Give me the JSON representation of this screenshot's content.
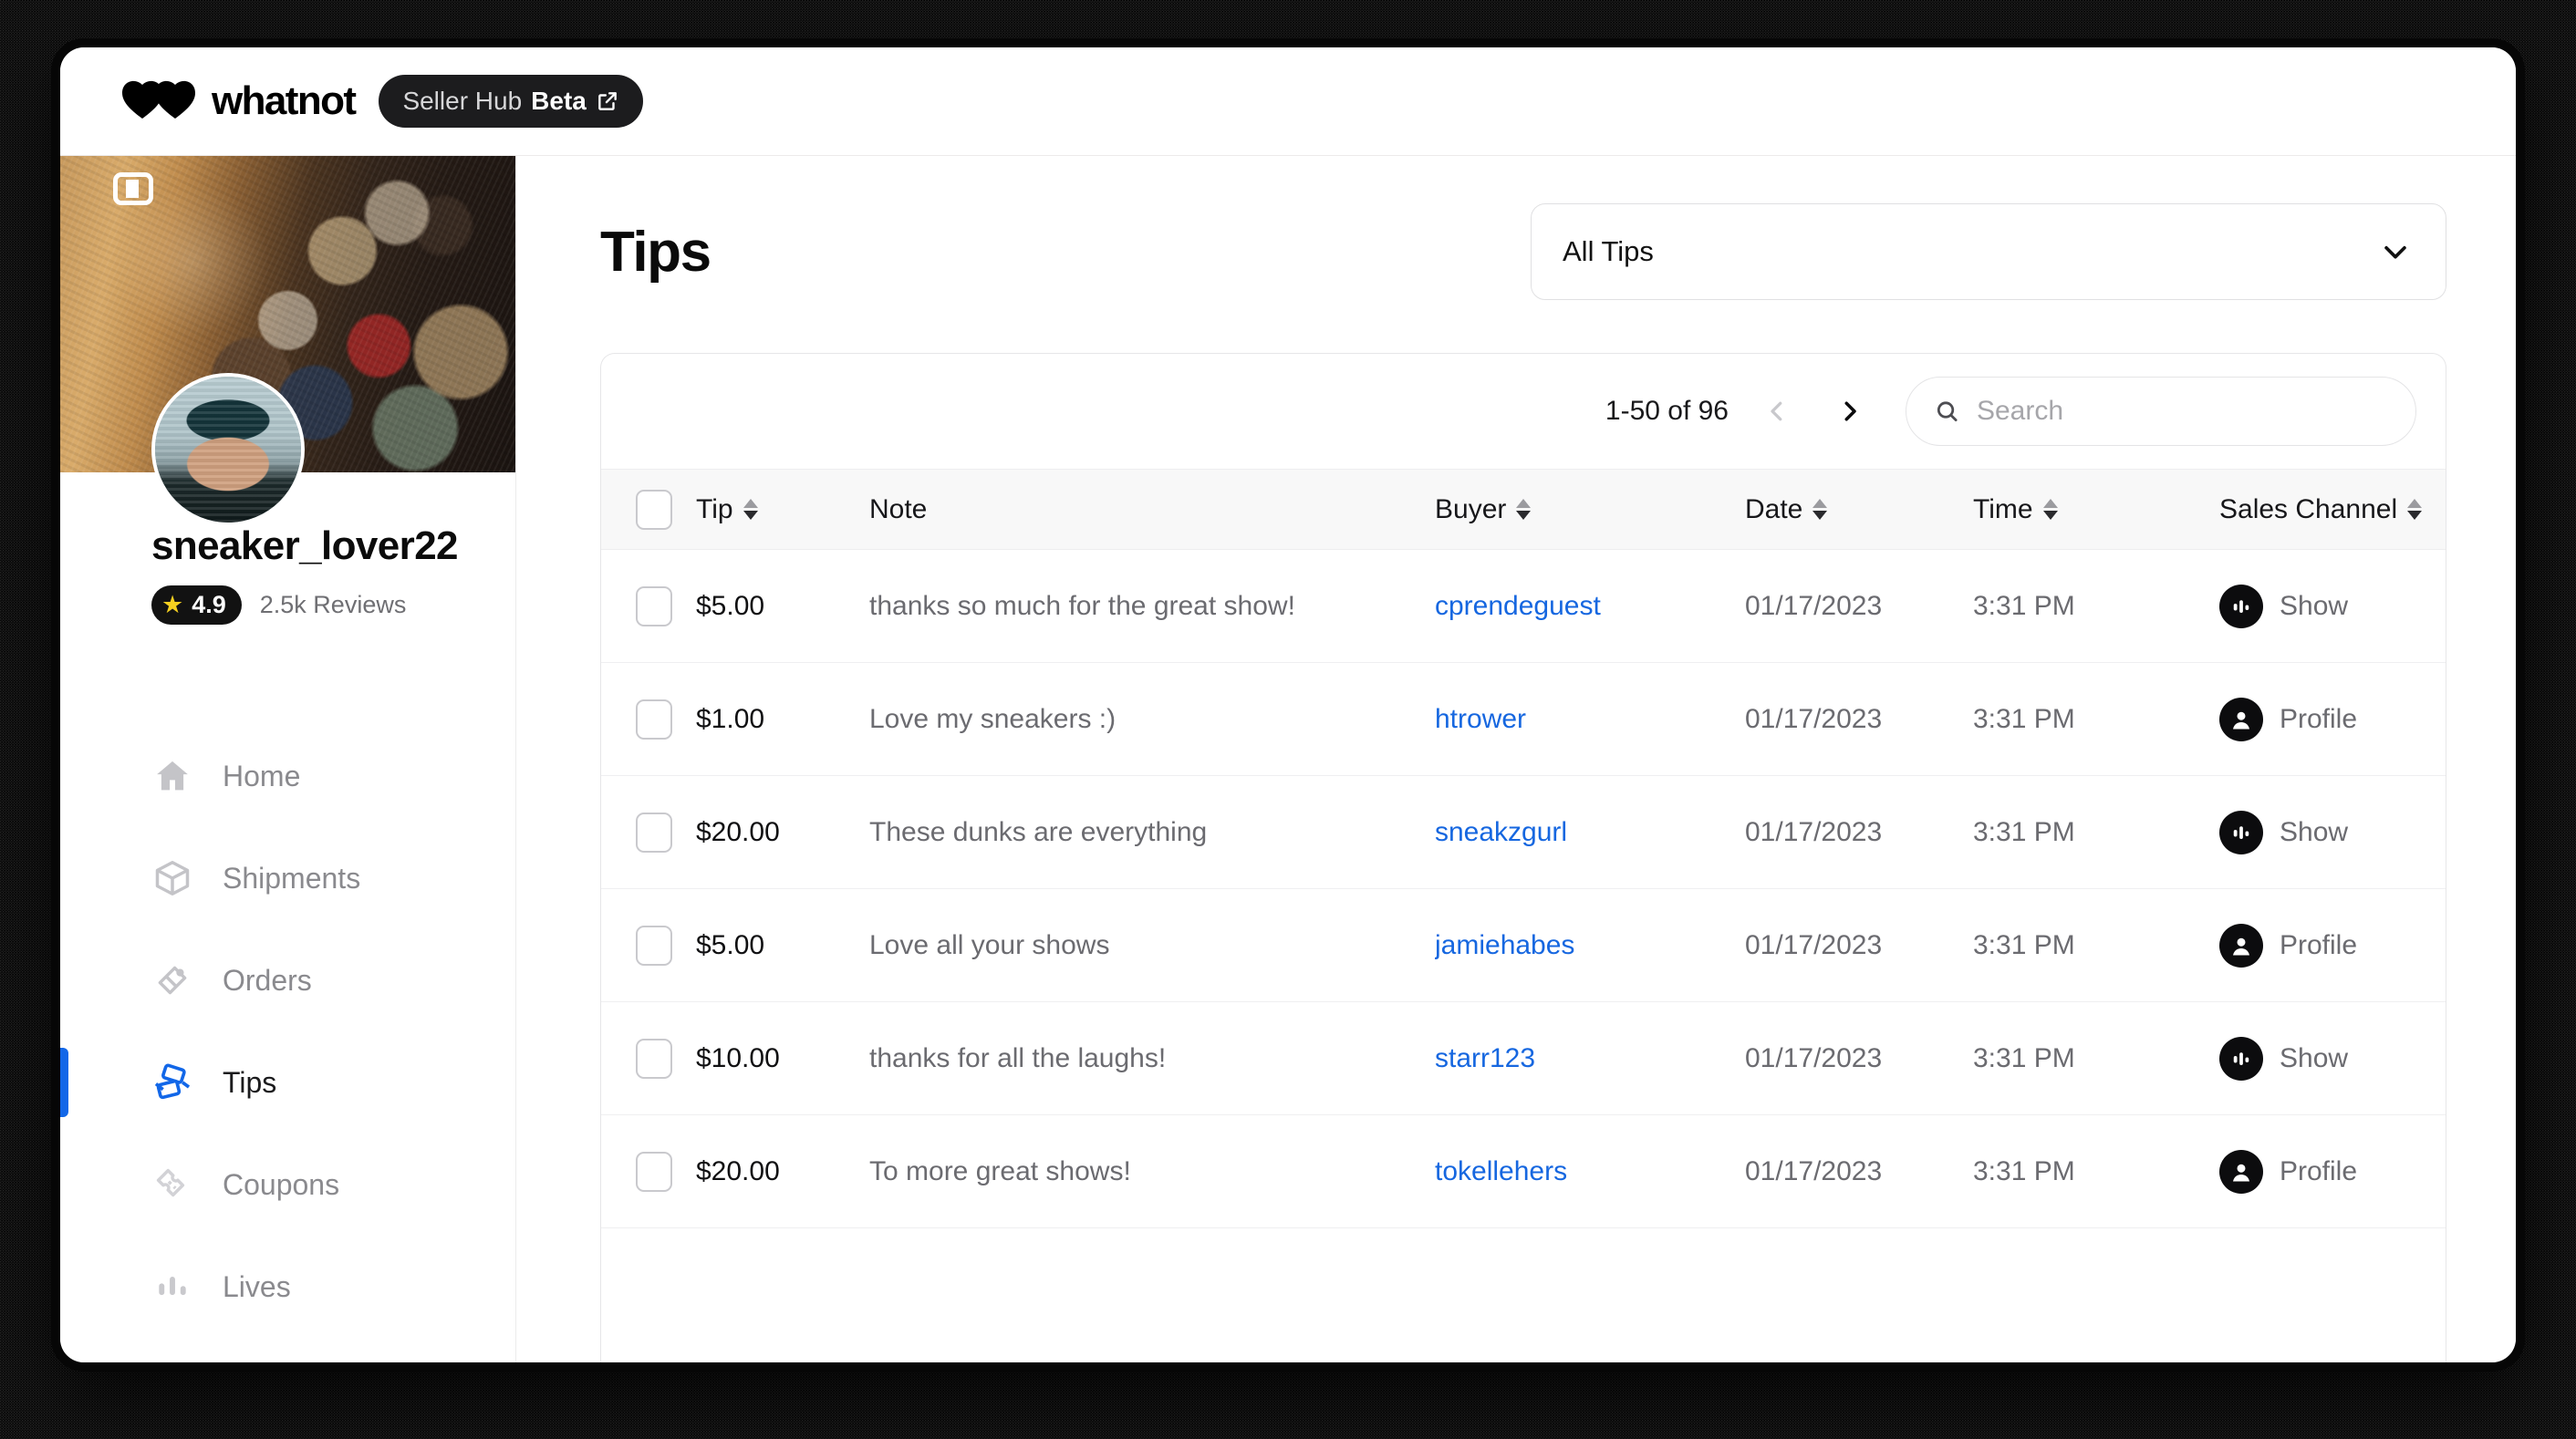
{
  "topbar": {
    "brand": "whatnot",
    "beta_pill": {
      "prefix": "Seller Hub",
      "bold": "Beta",
      "external_icon": "external-link-icon"
    }
  },
  "sidebar": {
    "collapse_icon": "sidebar-collapse-icon",
    "profile": {
      "username": "sneaker_lover22",
      "rating": "4.9",
      "star_icon": "star-icon",
      "reviews": "2.5k Reviews"
    },
    "items": [
      {
        "label": "Home",
        "icon": "home-icon",
        "active": false
      },
      {
        "label": "Shipments",
        "icon": "box-icon",
        "active": false
      },
      {
        "label": "Orders",
        "icon": "receipt-icon",
        "active": false
      },
      {
        "label": "Tips",
        "icon": "tips-cash-icon",
        "active": true
      },
      {
        "label": "Coupons",
        "icon": "ticket-icon",
        "active": false
      },
      {
        "label": "Lives",
        "icon": "bars-icon",
        "active": false
      }
    ]
  },
  "main": {
    "title": "Tips",
    "filter": {
      "value": "All Tips",
      "chevron_icon": "chevron-down-icon"
    },
    "toolbar": {
      "pager_label": "1-50 of 96",
      "prev_icon": "chevron-left-icon",
      "next_icon": "chevron-right-icon",
      "search_icon": "search-icon",
      "search_value": "",
      "search_placeholder": "Search"
    },
    "table": {
      "columns": [
        {
          "key": "check",
          "label": "",
          "sortable": false
        },
        {
          "key": "tip",
          "label": "Tip",
          "sortable": true
        },
        {
          "key": "note",
          "label": "Note",
          "sortable": false
        },
        {
          "key": "buyer",
          "label": "Buyer",
          "sortable": true
        },
        {
          "key": "date",
          "label": "Date",
          "sortable": true
        },
        {
          "key": "time",
          "label": "Time",
          "sortable": true
        },
        {
          "key": "channel",
          "label": "Sales Channel",
          "sortable": true
        },
        {
          "key": "action",
          "label": "",
          "sortable": false
        }
      ],
      "rows": [
        {
          "tip": "$5.00",
          "note": "thanks so much for the great show!",
          "buyer": "cprendeguest",
          "date": "01/17/2023",
          "time": "3:31 PM",
          "channel": "Show",
          "channel_icon": "live-show-icon",
          "action_icon": "chat-bubble-icon"
        },
        {
          "tip": "$1.00",
          "note": "Love my sneakers :)",
          "buyer": "htrower",
          "date": "01/17/2023",
          "time": "3:31 PM",
          "channel": "Profile",
          "channel_icon": "person-icon",
          "action_icon": "chat-bubble-icon"
        },
        {
          "tip": "$20.00",
          "note": "These dunks are everything",
          "buyer": "sneakzgurl",
          "date": "01/17/2023",
          "time": "3:31 PM",
          "channel": "Show",
          "channel_icon": "live-show-icon",
          "action_icon": "chat-bubble-icon"
        },
        {
          "tip": "$5.00",
          "note": "Love all your shows",
          "buyer": "jamiehabes",
          "date": "01/17/2023",
          "time": "3:31 PM",
          "channel": "Profile",
          "channel_icon": "person-icon",
          "action_icon": "chat-bubble-icon"
        },
        {
          "tip": "$10.00",
          "note": "thanks for all the laughs!",
          "buyer": "starr123",
          "date": "01/17/2023",
          "time": "3:31 PM",
          "channel": "Show",
          "channel_icon": "live-show-icon",
          "action_icon": "chat-bubble-icon"
        },
        {
          "tip": "$20.00",
          "note": "To more great shows!",
          "buyer": "tokellehers",
          "date": "01/17/2023",
          "time": "3:31 PM",
          "channel": "Profile",
          "channel_icon": "person-icon",
          "action_icon": "chat-bubble-icon"
        }
      ]
    }
  },
  "colors": {
    "accent_blue": "#1267e8",
    "link_blue": "#1667e0",
    "star_yellow": "#f5d020",
    "ink": "#0a0a0a",
    "muted": "#8a8a8e"
  }
}
